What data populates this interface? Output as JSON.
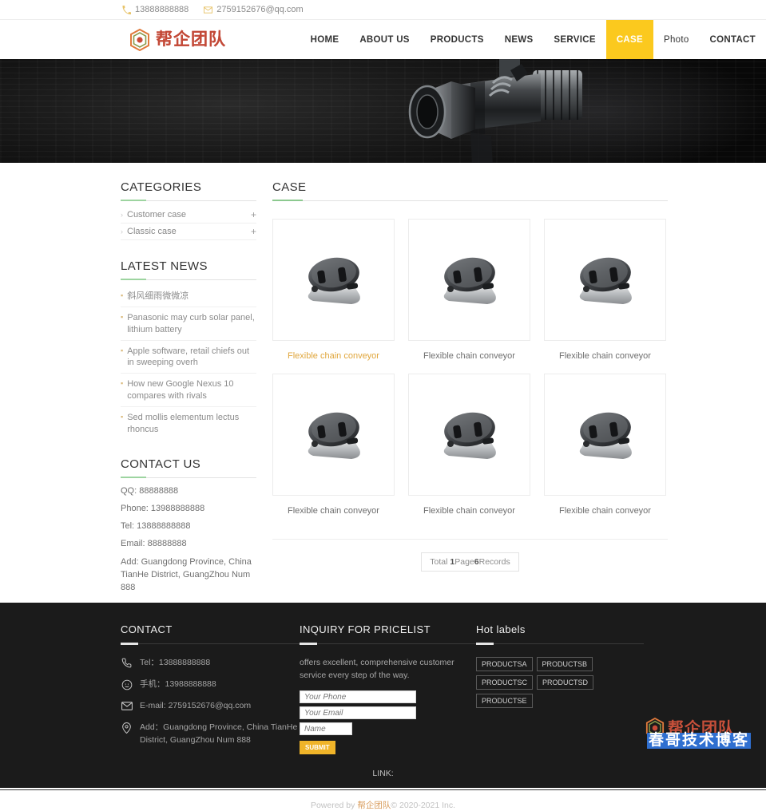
{
  "topbar": {
    "phone": "13888888888",
    "email": "2759152676@qq.com",
    "phone_icon": "phone-icon",
    "email_icon": "envelope-icon"
  },
  "header": {
    "logo_text": "帮企团队",
    "nav": [
      {
        "label": "HOME",
        "active": false,
        "style": "bold"
      },
      {
        "label": "ABOUT US",
        "active": false,
        "style": "bold"
      },
      {
        "label": "PRODUCTS",
        "active": false,
        "style": "bold"
      },
      {
        "label": "NEWS",
        "active": false,
        "style": "bold"
      },
      {
        "label": "SERVICE",
        "active": false,
        "style": "bold"
      },
      {
        "label": "CASE",
        "active": true,
        "style": "bold"
      },
      {
        "label": "Photo",
        "active": false,
        "style": "plain"
      },
      {
        "label": "CONTACT",
        "active": false,
        "style": "bold"
      }
    ]
  },
  "sidebar": {
    "categories_title": "CATEGORIES",
    "categories": [
      {
        "label": "Customer case",
        "expand": "+"
      },
      {
        "label": "Classic case",
        "expand": "+"
      }
    ],
    "news_title": "LATEST NEWS",
    "news": [
      {
        "label": "斜风细雨微微凉"
      },
      {
        "label": "Panasonic may curb solar panel, lithium battery"
      },
      {
        "label": "Apple software, retail chiefs out in sweeping overh"
      },
      {
        "label": "How new Google Nexus 10 compares with rivals"
      },
      {
        "label": "Sed mollis elementum lectus rhoncus"
      }
    ],
    "contact_title": "CONTACT US",
    "contact": [
      {
        "text": "QQ: 88888888"
      },
      {
        "text": "Phone: 13988888888"
      },
      {
        "text": "Tel: 13888888888"
      },
      {
        "text": "Email: 88888888"
      },
      {
        "text": "Add: Guangdong Province, China TianHe District, GuangZhou Num 888"
      }
    ]
  },
  "main": {
    "case_title": "CASE",
    "cards": [
      {
        "caption": "Flexible chain conveyor",
        "highlight": true
      },
      {
        "caption": "Flexible chain conveyor",
        "highlight": false
      },
      {
        "caption": "Flexible chain conveyor",
        "highlight": false
      },
      {
        "caption": "Flexible chain conveyor",
        "highlight": false
      },
      {
        "caption": "Flexible chain conveyor",
        "highlight": false
      },
      {
        "caption": "Flexible chain conveyor",
        "highlight": false
      }
    ],
    "pager": {
      "prefix": "Total ",
      "pages": "1",
      "mid": "Page",
      "records": "6",
      "suffix": "Records"
    }
  },
  "footer": {
    "contact_title": "CONTACT",
    "contact_items": [
      {
        "icon": "phone-icon",
        "text": "Tel：13888888888"
      },
      {
        "icon": "wechat-icon",
        "text": "手机：13988888888"
      },
      {
        "icon": "envelope-icon",
        "text": "E-mail: 2759152676@qq.com"
      },
      {
        "icon": "location-pin-icon",
        "text": "Add：Guangdong Province, China TianHe District, GuangZhou Num 888"
      }
    ],
    "inquiry_title": "INQUIRY FOR PRICELIST",
    "inquiry_desc": "offers excellent, comprehensive customer service every step of the way.",
    "form": {
      "phone_placeholder": "Your Phone",
      "email_placeholder": "Your Email",
      "name_placeholder": "Name",
      "submit_label": "SUBMIT"
    },
    "labels_title": "Hot labels",
    "labels": [
      {
        "label": "PRODUCTSA"
      },
      {
        "label": "PRODUCTSB"
      },
      {
        "label": "PRODUCTSC"
      },
      {
        "label": "PRODUCTSD"
      },
      {
        "label": "PRODUCTSE"
      }
    ],
    "link_label": "LINK:",
    "powered_prefix": "Powered by ",
    "powered_brand": "帮企团队",
    "powered_suffix": "© 2020-2021 Inc."
  },
  "watermark": {
    "brand": "帮企团队",
    "text": "春哥技术博客"
  }
}
